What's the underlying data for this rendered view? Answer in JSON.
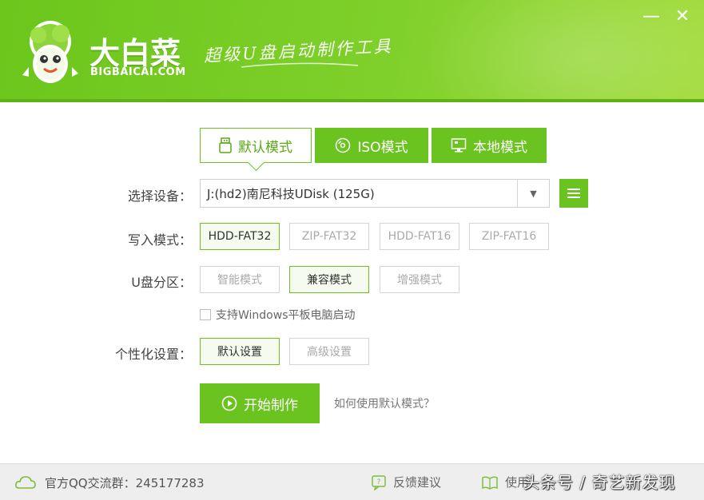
{
  "header": {
    "brand_cn": "大白菜",
    "brand_en": "BIGBAICAI.COM",
    "slogan": "超级U盘启动制作工具",
    "minimize_glyph": "—",
    "close_glyph": "✕",
    "colors": {
      "brand_green": "#6bc31f",
      "header_gradient_end": "#a4dc3e"
    }
  },
  "modes": {
    "default_label": "默认模式",
    "iso_label": "ISO模式",
    "local_label": "本地模式",
    "active": "default",
    "icons": [
      "usb-icon",
      "disc-icon",
      "monitor-icon"
    ]
  },
  "device": {
    "label": "选择设备：",
    "value": "J:(hd2)南尼科技UDisk (125G)"
  },
  "write_mode": {
    "label": "写入模式：",
    "options": [
      "HDD-FAT32",
      "ZIP-FAT32",
      "HDD-FAT16",
      "ZIP-FAT16"
    ],
    "selected": "HDD-FAT32"
  },
  "partition": {
    "label": "U盘分区：",
    "options": [
      "智能模式",
      "兼容模式",
      "增强模式"
    ],
    "selected": "兼容模式"
  },
  "windows_tablet": {
    "label": "支持Windows平板电脑启动",
    "checked": false
  },
  "custom": {
    "label": "个性化设置：",
    "options": [
      "默认设置",
      "高级设置"
    ],
    "selected": "默认设置"
  },
  "actions": {
    "start_label": "开始制作",
    "help_link": "如何使用默认模式？"
  },
  "footer": {
    "qq_group": "官方QQ交流群：245177283",
    "feedback": "反馈建议",
    "tutorial": "使用"
  },
  "watermark": "头条号 / 奇艺新发现"
}
